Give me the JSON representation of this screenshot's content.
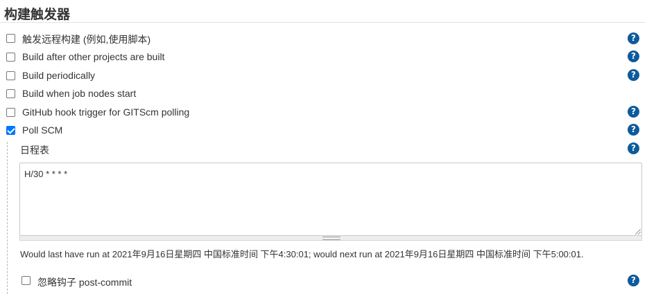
{
  "section": {
    "title": "构建触发器"
  },
  "triggers": [
    {
      "label": "触发远程构建 (例如,使用脚本)",
      "checked": false,
      "help": true
    },
    {
      "label": "Build after other projects are built",
      "checked": false,
      "help": true
    },
    {
      "label": "Build periodically",
      "checked": false,
      "help": true
    },
    {
      "label": "Build when job nodes start",
      "checked": false,
      "help": false
    },
    {
      "label": "GitHub hook trigger for GITScm polling",
      "checked": false,
      "help": true
    },
    {
      "label": "Poll SCM",
      "checked": true,
      "help": true
    }
  ],
  "poll_scm": {
    "schedule_label": "日程表",
    "schedule_value": "H/30 * * * *",
    "run_info": "Would last have run at 2021年9月16日星期四 中国标准时间 下午4:30:01; would next run at 2021年9月16日星期四 中国标准时间 下午5:00:01.",
    "ignore_post_commit": {
      "label": "忽略钩子 post-commit",
      "checked": false
    }
  },
  "help_glyph": "?",
  "colors": {
    "help_icon": "#0d5b9c",
    "checkbox_checked": "#0075ff"
  }
}
